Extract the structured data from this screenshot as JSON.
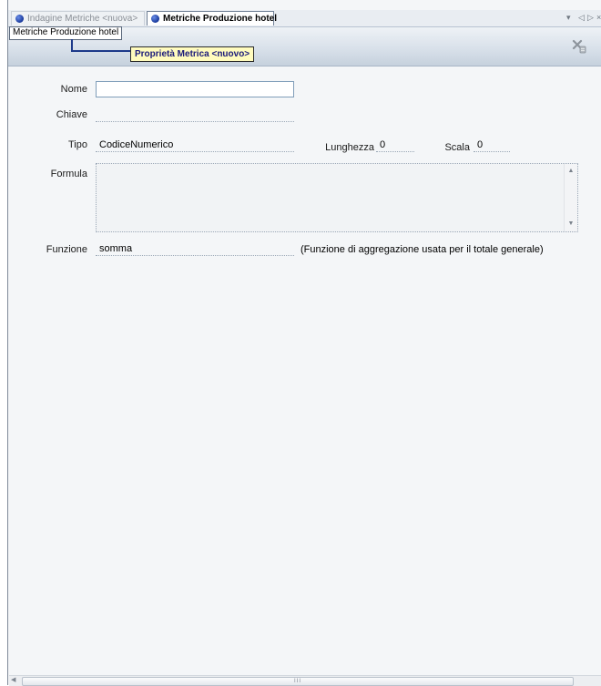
{
  "tabs": {
    "inactive_label": "Indagine Metriche <nuova>",
    "active_label": "Metriche Produzione hotel",
    "controls": [
      "▾",
      "◁",
      "▷",
      "×"
    ]
  },
  "header": {
    "breadcrumb": "Metriche Produzione hotel",
    "panel_title": "Proprietà Metrica <nuovo>",
    "toolbar_icon": "delete-metric-icon"
  },
  "form": {
    "nome": {
      "label": "Nome",
      "value": ""
    },
    "chiave": {
      "label": "Chiave",
      "value": ""
    },
    "tipo": {
      "label": "Tipo",
      "value": "CodiceNumerico"
    },
    "lunghezza": {
      "label": "Lunghezza",
      "value": "0"
    },
    "scala": {
      "label": "Scala",
      "value": "0"
    },
    "formula": {
      "label": "Formula",
      "value": ""
    },
    "funzione": {
      "label": "Funzione",
      "value": "somma",
      "note": "(Funzione di aggregazione usata per il totale generale)"
    }
  },
  "scrollbar": {
    "grip": "III"
  }
}
